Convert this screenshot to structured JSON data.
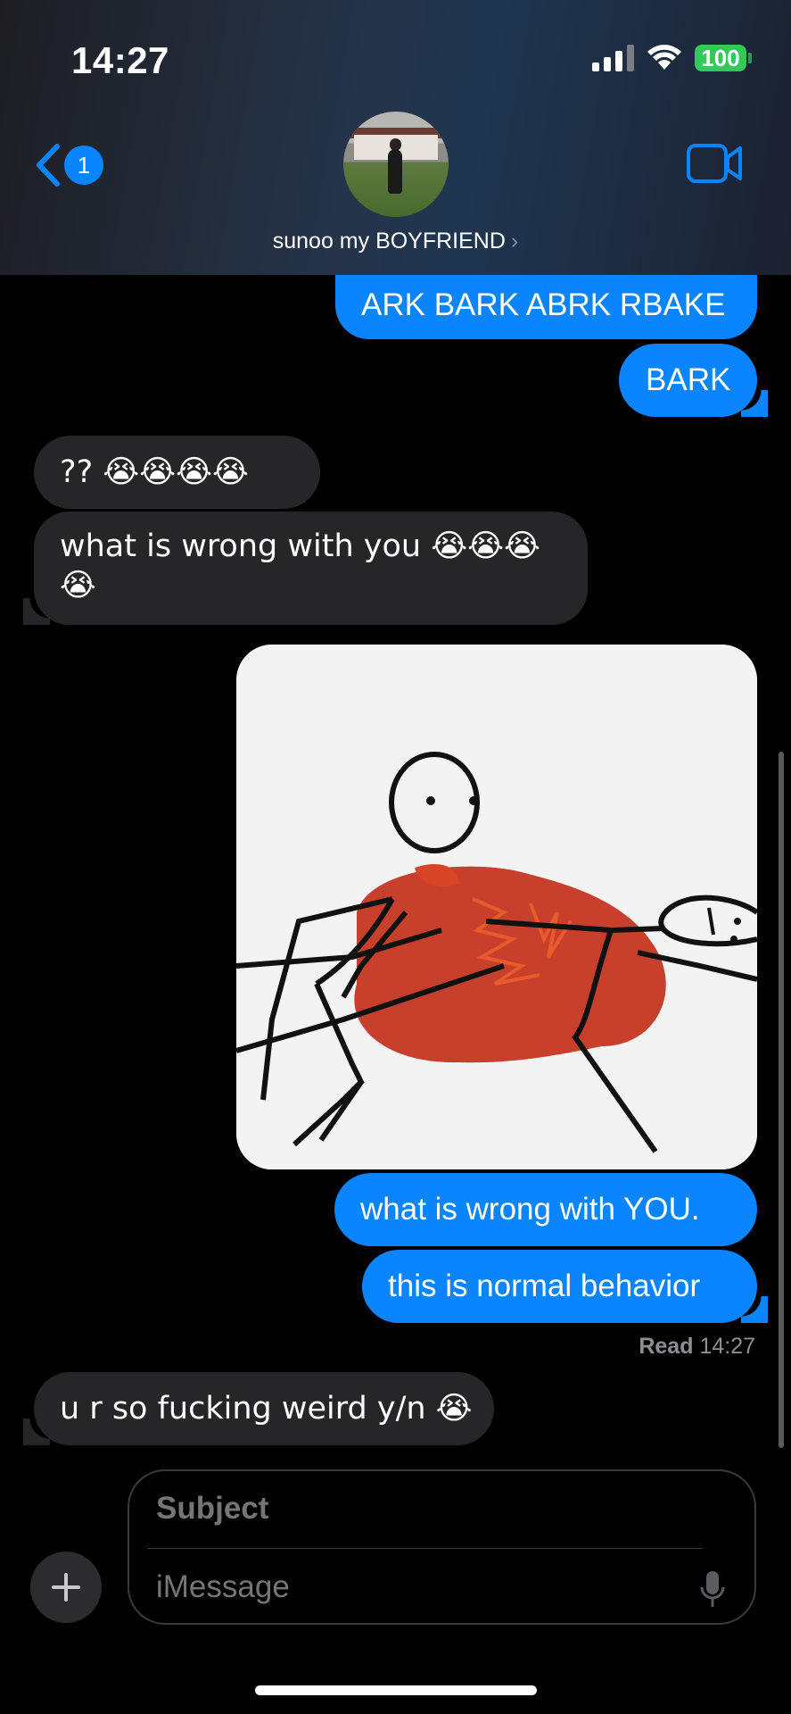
{
  "status_bar": {
    "time": "14:27",
    "battery": "100"
  },
  "header": {
    "back_badge": "1",
    "contact_name": "sunoo my BOYFRIEND",
    "chevron": "›"
  },
  "messages": [
    {
      "from": "me",
      "text": "ARK BARK ABRK RBAKE"
    },
    {
      "from": "me",
      "text": "BARK"
    },
    {
      "from": "them",
      "text": "?? 😭😭😭😭"
    },
    {
      "from": "them",
      "line1": "what is wrong with you 😭😭😭",
      "line2": "😭"
    },
    {
      "from": "me",
      "type": "image",
      "description_icon": "stick-figure-image"
    },
    {
      "from": "me",
      "text": "what is wrong with YOU."
    },
    {
      "from": "me",
      "text": "this is normal behavior"
    },
    {
      "from": "them",
      "text": "u r so fucking weird y/n 😭"
    }
  ],
  "read_receipt": {
    "label": "Read",
    "time": "14:27"
  },
  "composer": {
    "subject_placeholder": "Subject",
    "message_placeholder": "iMessage"
  },
  "colors": {
    "sent_bubble": "#0a84ff",
    "received_bubble": "#262628",
    "battery": "#34c759"
  }
}
